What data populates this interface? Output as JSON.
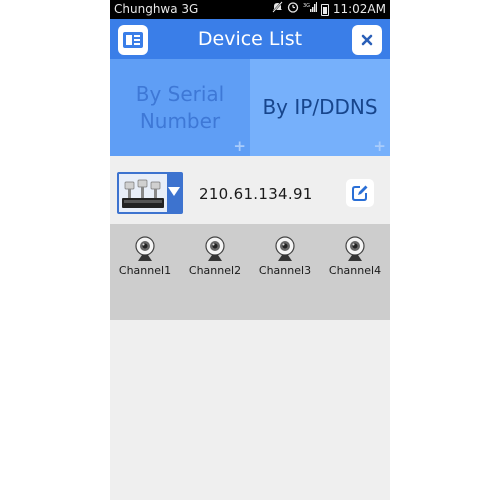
{
  "status_bar": {
    "carrier": "Chunghwa 3G",
    "time": "11:02AM",
    "icons": [
      "mute-icon",
      "alarm-icon",
      "signal-icon",
      "battery-icon"
    ]
  },
  "header": {
    "title": "Device List",
    "left_icon": "device-list-icon",
    "right_icon": "close-icon",
    "color": "#3a7ee8"
  },
  "tabs": [
    {
      "label_line1": "By Serial",
      "label_line2": "Number",
      "add": "+"
    },
    {
      "label": "By IP/DDNS",
      "add": "+"
    }
  ],
  "device": {
    "address": "210.61.134.91",
    "thumbnail_icon": "dvr-camera-icon",
    "dropdown_icon": "dropdown-arrow-icon",
    "edit_icon": "edit-icon"
  },
  "channels": [
    {
      "label": "Channel1"
    },
    {
      "label": "Channel2"
    },
    {
      "label": "Channel3"
    },
    {
      "label": "Channel4"
    }
  ]
}
